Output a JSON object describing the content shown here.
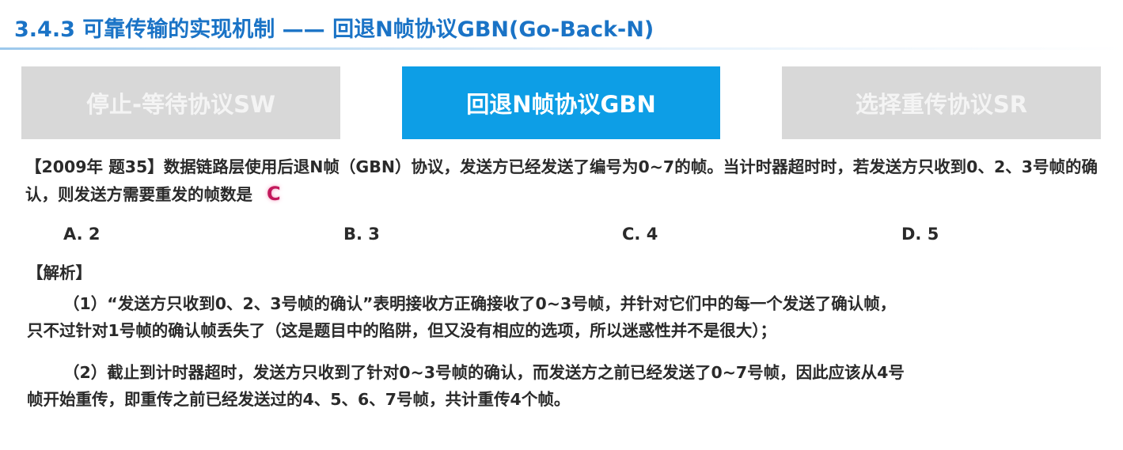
{
  "page_title": "3.4.3 可靠传输的实现机制 —— 回退N帧协议GBN(Go-Back-N)",
  "tabs": [
    {
      "label": "停止-等待协议SW",
      "active": false
    },
    {
      "label": "回退N帧协议GBN",
      "active": true
    },
    {
      "label": "选择重传协议SR",
      "active": false
    }
  ],
  "question": {
    "text": "【2009年 题35】数据链路层使用后退N帧（GBN）协议，发送方已经发送了编号为0~7的帧。当计时器超时时，若发送方只收到0、2、3号帧的确认，则发送方需要重发的帧数是",
    "answer_mark": "C"
  },
  "options": [
    "A. 2",
    "B. 3",
    "C. 4",
    "D. 5"
  ],
  "solution": {
    "heading": "【解析】",
    "p1_line1": "（1）“发送方只收到0、2、3号帧的确认”表明接收方正确接收了0~3号帧，并针对它们中的每一个发送了确认帧，",
    "p1_line2": "只不过针对1号帧的确认帧丢失了（这是题目中的陷阱，但又没有相应的选项，所以迷惑性并不是很大）；",
    "p2_line1": "（2）截止到计时器超时，发送方只收到了针对0~3号帧的确认，而发送方之前已经发送了0~7号帧，因此应该从4号",
    "p2_line2": "帧开始重传，即重传之前已经发送过的4、5、6、7号帧，共计重传4个帧。"
  },
  "colors": {
    "title": "#1a73c6",
    "tab_active_bg": "#0d9ee6",
    "tab_inactive_bg": "#d8d8d8",
    "answer_mark": "#c2185b"
  }
}
